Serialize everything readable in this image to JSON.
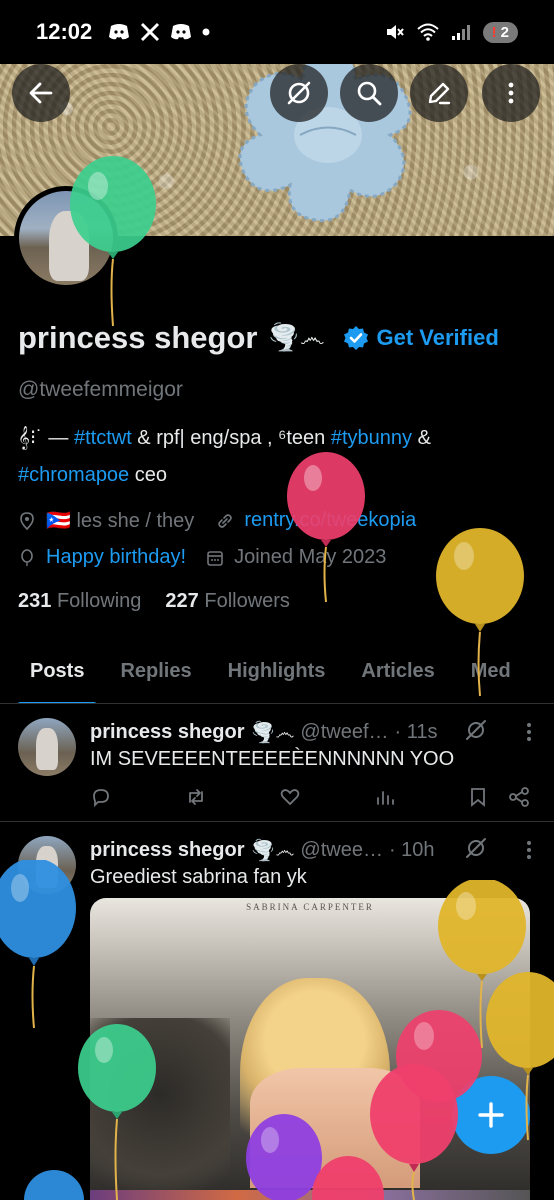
{
  "status_bar": {
    "time": "12:02",
    "left_icons": [
      "discord-icon",
      "x-icon",
      "discord-icon",
      "dot-icon"
    ],
    "battery_count": "2",
    "battery_alert": "!"
  },
  "header": {
    "back_icon": "back-arrow-icon",
    "grok_icon": "grok-icon",
    "search_icon": "search-icon",
    "edit_icon": "edit-icon",
    "more_icon": "more-vertical-icon"
  },
  "profile": {
    "display_name": "princess shegor",
    "name_emoji": "🌪️෴",
    "verified_cta": "Get Verified",
    "handle": "@tweefemmeigor",
    "bio": {
      "line1_prefix": "𝄞⁝˙ — ",
      "tag1": "#ttctwt",
      "line1_mid": " & rpf|   eng/spa , ⁶teen ",
      "tag2": "#tybunny",
      "line1_suffix": " &",
      "tag3": "#chromapoe",
      "line2_suffix": " ceo"
    },
    "location": "🇵🇷  les  she / they",
    "link": "rentry.co/tweekopia",
    "birthday": "Happy birthday!",
    "joined": "Joined May 2023",
    "following_count": "231",
    "following_label": "Following",
    "followers_count": "227",
    "followers_label": "Followers"
  },
  "tabs": [
    {
      "label": "Posts",
      "active": true
    },
    {
      "label": "Replies",
      "active": false
    },
    {
      "label": "Highlights",
      "active": false
    },
    {
      "label": "Articles",
      "active": false
    },
    {
      "label": "Med",
      "active": false
    }
  ],
  "posts": [
    {
      "name": "princess shegor",
      "emoji": "🌪️෴",
      "handle": "@tweef…",
      "time": "· 11s",
      "text": "IM SEVEEEENTEEEEÈENNNNNN YOO"
    },
    {
      "name": "princess shegor",
      "emoji": "🌪️෴",
      "handle": "@twee…",
      "time": "· 10h",
      "text": "Greediest sabrina fan yk",
      "media_title": "SABRINA CARPENTER"
    }
  ],
  "fab": {
    "icon": "plus-icon"
  },
  "colors": {
    "accent": "#1d9bf0",
    "background": "#000000",
    "text": "#e7e9ea",
    "muted": "#71767b"
  }
}
